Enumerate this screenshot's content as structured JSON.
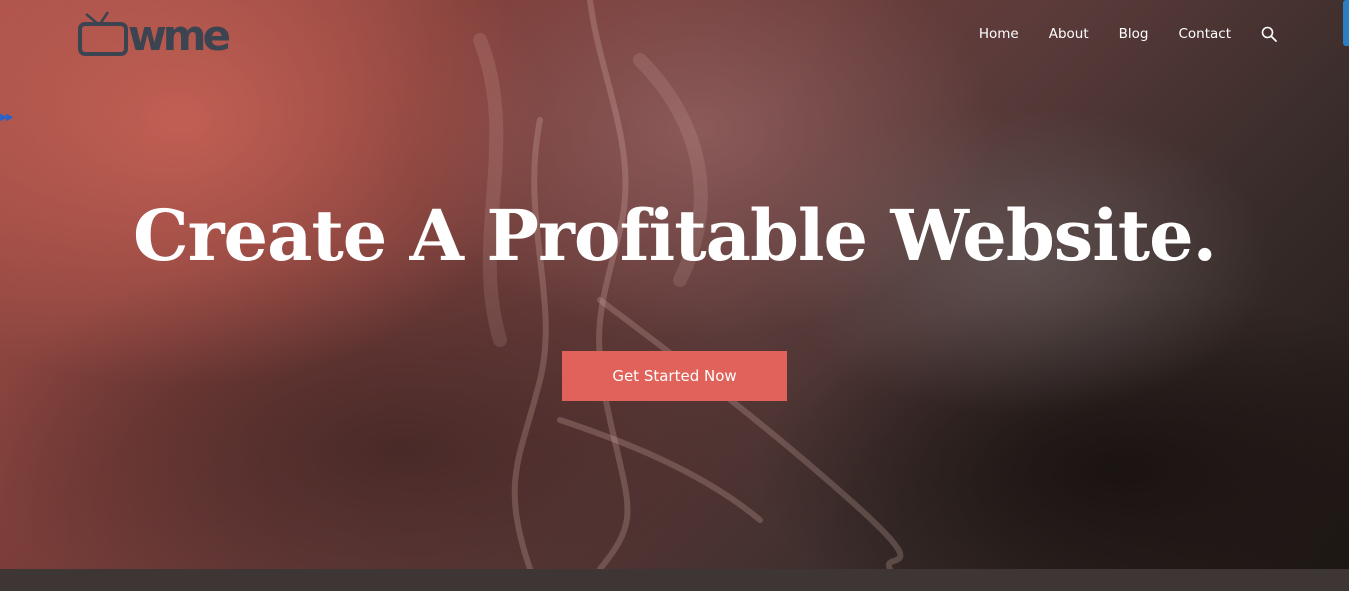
{
  "header": {
    "logo_text": "wme",
    "nav": [
      {
        "label": "Home"
      },
      {
        "label": "About"
      },
      {
        "label": "Blog"
      },
      {
        "label": "Contact"
      }
    ],
    "search_icon": "search-icon"
  },
  "hero": {
    "headline": "Create A Profitable Website.",
    "cta_label": "Get Started Now",
    "skip_glyph": "▶▶"
  },
  "colors": {
    "accent": "#e0625a",
    "logo": "#3b4450",
    "side_tab": "#2a7fc4"
  }
}
